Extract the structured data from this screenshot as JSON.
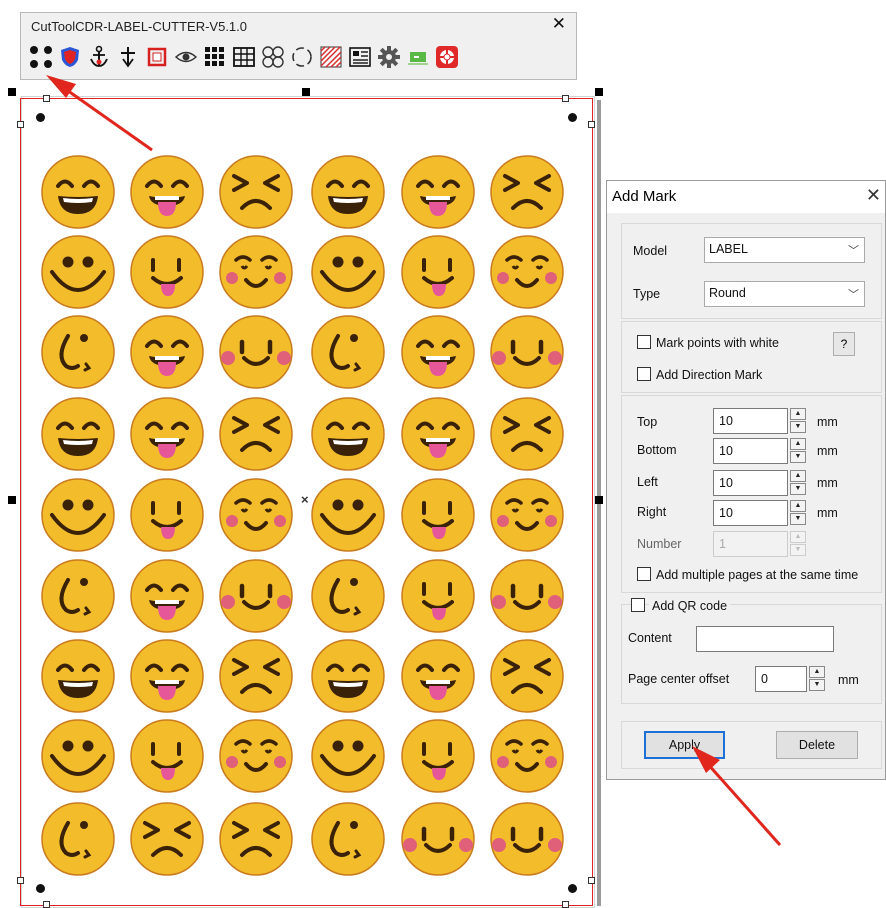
{
  "toolbar": {
    "title": "CutToolCDR-LABEL-CUTTER-V5.1.0",
    "close": "✕",
    "tools": [
      "four-dots-icon",
      "red-shield-icon",
      "anchor-icon",
      "pin-icon",
      "red-square-icon",
      "eye-icon",
      "dot-grid-icon",
      "table-grid-icon",
      "four-circles-icon",
      "dashed-circle-icon",
      "hatched-square-icon",
      "layout-icon",
      "gear-icon",
      "green-arrow-icon",
      "lifebuoy-icon"
    ]
  },
  "canvas": {
    "center_mark": "×",
    "emoji_rows": [
      [
        "grin",
        "tongue",
        "squint",
        "grin",
        "tongue",
        "squint"
      ],
      [
        "smile",
        "tongue-small",
        "blush",
        "smile",
        "tongue-small",
        "blush"
      ],
      [
        "wink",
        "tongue",
        "cheeks",
        "wink",
        "tongue",
        "cheeks"
      ],
      [
        "grin",
        "tongue",
        "squint",
        "grin",
        "tongue",
        "squint"
      ],
      [
        "smile",
        "tongue-small",
        "blush",
        "smile",
        "tongue-small",
        "blush"
      ],
      [
        "wink",
        "tongue",
        "cheeks",
        "wink",
        "tongue-small",
        "cheeks"
      ],
      [
        "grin",
        "tongue",
        "squint",
        "grin",
        "tongue",
        "squint"
      ],
      [
        "smile",
        "tongue-small",
        "blush",
        "smile",
        "tongue-small",
        "blush"
      ],
      [
        "wink",
        "squint",
        "squint",
        "wink",
        "cheeks",
        "cheeks"
      ]
    ]
  },
  "dialog": {
    "title": "Add Mark",
    "close": "✕",
    "model_label": "Model",
    "model_value": "LABEL",
    "type_label": "Type",
    "type_value": "Round",
    "mark_white_label": "Mark points with white",
    "help_label": "?",
    "direction_label": "Add Direction Mark",
    "top_label": "Top",
    "top_value": "10",
    "bottom_label": "Bottom",
    "bottom_value": "10",
    "left_label": "Left",
    "left_value": "10",
    "right_label": "Right",
    "right_value": "10",
    "number_label": "Number",
    "number_value": "1",
    "unit": "mm",
    "multi_pages_label": "Add multiple pages at the same time",
    "qr_label": "Add QR code",
    "content_label": "Content",
    "content_value": "",
    "offset_label": "Page center offset",
    "offset_value": "0",
    "apply_label": "Apply",
    "delete_label": "Delete"
  },
  "colors": {
    "emoji_face": "#f2bc2a",
    "emoji_outline": "#c97b1e",
    "feature": "#3a2208",
    "tongue": "#e6579a",
    "cheek": "#e0607a",
    "arrow": "#e0261d",
    "trim_line": "#dd2222",
    "focus_blue": "#1d70d6"
  }
}
